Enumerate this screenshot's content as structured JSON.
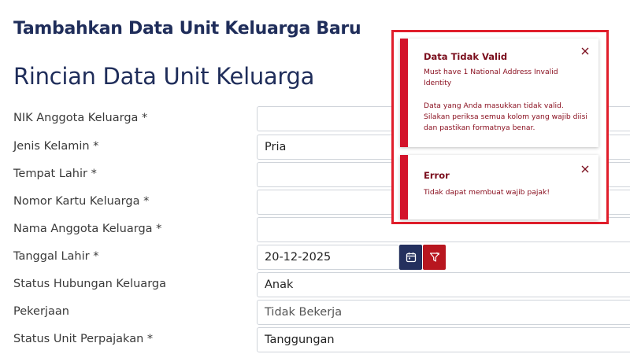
{
  "page": {
    "heading": "Tambahkan Data Unit Keluarga Baru",
    "section_title": "Rincian Data Unit Keluarga"
  },
  "form": {
    "nik": {
      "label": "NIK Anggota Keluarga *",
      "value": ""
    },
    "jenis_kelamin": {
      "label": "Jenis Kelamin *",
      "value": "Pria"
    },
    "tempat_lahir": {
      "label": "Tempat Lahir *",
      "value": ""
    },
    "nomor_kk": {
      "label": "Nomor Kartu Keluarga *",
      "value": ""
    },
    "nama": {
      "label": "Nama Anggota Keluarga *",
      "value": ""
    },
    "tanggal_lahir": {
      "label": "Tanggal Lahir *",
      "value": "20-12-2025"
    },
    "status_hubungan": {
      "label": "Status Hubungan Keluarga",
      "value": "Anak"
    },
    "pekerjaan": {
      "label": "Pekerjaan",
      "value": "Tidak Bekerja"
    },
    "status_unit_pajak": {
      "label": "Status Unit Perpajakan *",
      "value": "Tanggungan"
    }
  },
  "icons": {
    "calendar": "calendar-icon",
    "clear": "filter-clear-icon",
    "close": "close-icon"
  },
  "colors": {
    "heading": "#1f2d5a",
    "calendar_button": "#24305e",
    "clear_button": "#b8161f",
    "toast_accent": "#d3122a",
    "toast_frame": "#e01e2b",
    "toast_text": "#7a0d1c"
  },
  "toasts": {
    "invalid": {
      "title": "Data Tidak Valid",
      "message_line1": "Must have 1 National Address Invalid",
      "message_line2": "Identity",
      "detail_line1": "Data yang Anda masukkan tidak valid.",
      "detail_line2": "Silakan periksa semua kolom yang wajib diisi",
      "detail_line3": "dan pastikan formatnya benar."
    },
    "error": {
      "title": "Error",
      "message": "Tidak dapat membuat wajib pajak!"
    }
  }
}
